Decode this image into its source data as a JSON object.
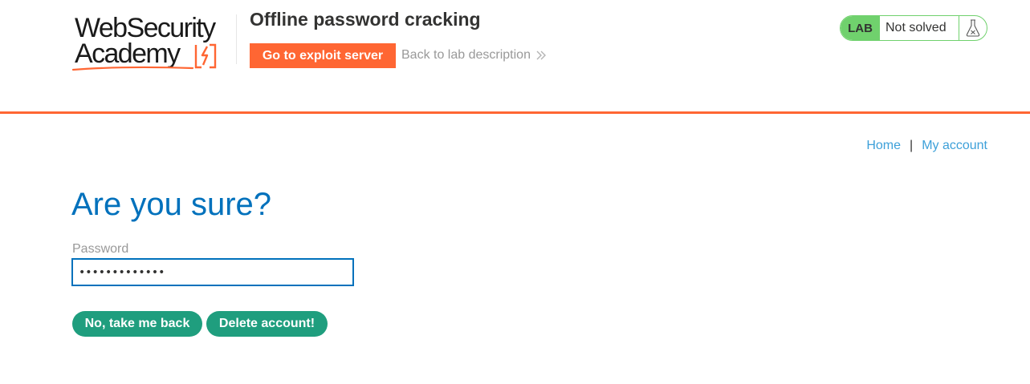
{
  "header": {
    "logo_line1": "WebSecurity",
    "logo_line2": "Academy",
    "lab_title": "Offline password cracking",
    "exploit_button": "Go to exploit server",
    "back_link": "Back to lab description",
    "lab_badge": "LAB",
    "lab_status": "Not solved",
    "accent_color": "#ff6633",
    "status_color": "#70d16d"
  },
  "nav": {
    "home": "Home",
    "separator": "|",
    "account": "My account"
  },
  "main": {
    "title": "Are you sure?",
    "password_label": "Password",
    "password_value": "•••••••••••••",
    "no_button": "No, take me back",
    "delete_button": "Delete account!"
  },
  "icons": {
    "logo_mark": "lightning-bracket-icon",
    "back_chevrons": "double-chevron-right-icon",
    "status_icon": "flask-icon"
  }
}
